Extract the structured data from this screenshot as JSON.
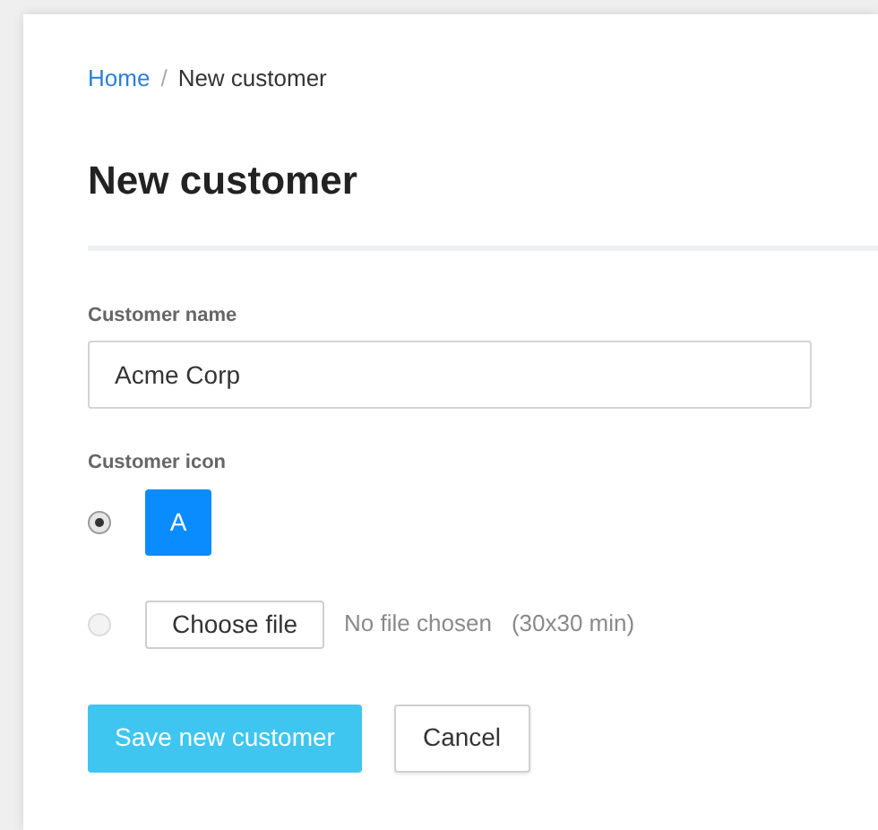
{
  "breadcrumb": {
    "items": [
      {
        "label": "Home",
        "kind": "link"
      },
      {
        "label": "New customer",
        "kind": "current"
      }
    ],
    "separator": "/"
  },
  "title": "New customer",
  "name_field": {
    "label": "Customer name",
    "value": "Acme Corp"
  },
  "icon_field": {
    "label": "Customer icon",
    "options": [
      {
        "kind": "avatar",
        "selected": true,
        "letter": "A"
      },
      {
        "kind": "file",
        "selected": false,
        "button": "Choose file",
        "status": "No file chosen",
        "hint": "(30x30 min)"
      }
    ]
  },
  "buttons": [
    {
      "label": "Save new customer",
      "kind": "primary"
    },
    {
      "label": "Cancel",
      "kind": "secondary"
    }
  ]
}
